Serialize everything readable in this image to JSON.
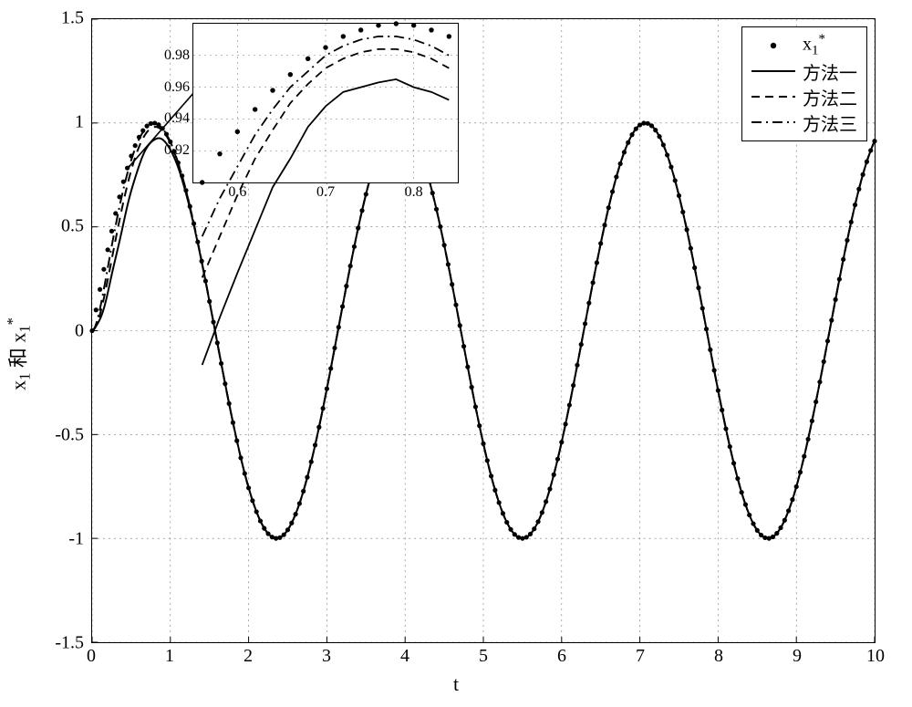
{
  "chart_data": {
    "type": "line",
    "xlabel": "t",
    "ylabel": "x₁ 和 x₁*",
    "x_range": [
      0,
      10
    ],
    "y_range": [
      -1.5,
      1.5
    ],
    "x_ticks": [
      0,
      1,
      2,
      3,
      4,
      5,
      6,
      7,
      8,
      9,
      10
    ],
    "y_ticks": [
      -1.5,
      -1,
      -0.5,
      0,
      0.5,
      1,
      1.5
    ],
    "legend": {
      "position": "upper right",
      "entries": [
        {
          "label": "x₁*",
          "style": "dots"
        },
        {
          "label": "方法一",
          "style": "solid"
        },
        {
          "label": "方法二",
          "style": "dashed"
        },
        {
          "label": "方法三",
          "style": "dashdot"
        }
      ]
    },
    "series": [
      {
        "name": "x₁*",
        "style": "dots",
        "description": "Target trajectory x1* = sin(2t), shown as discrete dots every ≈0.05 in t over [0,10]."
      },
      {
        "name": "方法一",
        "style": "solid",
        "description": "Method 1 response, starts at 0 at t=0, converges toward sin(2t). Undershoots first peak, x1≈0.965 at t≈0.78."
      },
      {
        "name": "方法二",
        "style": "dashed",
        "description": "Method 2 response, converges faster than 方法一, first peak x1≈0.984 at t≈0.78."
      },
      {
        "name": "方法三",
        "style": "dashdot",
        "description": "Method 3 response, nearly matches target, first peak x1≈0.992 at t≈0.78."
      }
    ],
    "note": "After roughly t≈1 all three methods visually coincide with x1* on the main axes, producing a single thick sinusoid sin(2t) of amplitude 1, period π.",
    "annotation_arrow": {
      "from_t": 0.5,
      "from_x": 0.85,
      "to": "inset"
    },
    "inset": {
      "x_range": [
        0.55,
        0.85
      ],
      "y_range": [
        0.9,
        1.0
      ],
      "x_ticks": [
        0.6,
        0.7,
        0.8
      ],
      "y_ticks": [
        0.92,
        0.94,
        0.96,
        0.98
      ],
      "series_detail": {
        "x": [
          0.56,
          0.58,
          0.6,
          0.62,
          0.64,
          0.66,
          0.68,
          0.7,
          0.72,
          0.74,
          0.76,
          0.78,
          0.8,
          0.82,
          0.84
        ],
        "x1_star": [
          0.9,
          0.918,
          0.932,
          0.946,
          0.958,
          0.968,
          0.978,
          0.985,
          0.992,
          0.996,
          0.999,
          1.0,
          0.999,
          0.996,
          0.992
        ],
        "method1": [
          0.785,
          0.815,
          0.843,
          0.87,
          0.897,
          0.915,
          0.935,
          0.948,
          0.957,
          0.96,
          0.963,
          0.965,
          0.96,
          0.957,
          0.952
        ],
        "method2": [
          0.84,
          0.866,
          0.892,
          0.915,
          0.933,
          0.95,
          0.962,
          0.972,
          0.978,
          0.982,
          0.984,
          0.984,
          0.982,
          0.978,
          0.972
        ],
        "method3": [
          0.866,
          0.89,
          0.91,
          0.93,
          0.946,
          0.96,
          0.97,
          0.98,
          0.986,
          0.99,
          0.992,
          0.992,
          0.99,
          0.986,
          0.98
        ]
      }
    }
  },
  "labels": {
    "xlabel": "t",
    "ylabel_prefix": "x",
    "ylabel_sub": "1",
    "ylabel_and": " 和 ",
    "ylabel_suffix_sub": "1",
    "ylabel_suffix_sup": "*",
    "legend0_a": "x",
    "legend0_b": "1",
    "legend0_c": "*",
    "legend1": "方法一",
    "legend2": "方法二",
    "legend3": "方法三",
    "yticks": {
      "0": "-1.5",
      "1": "-1",
      "2": "-0.5",
      "3": "0",
      "4": "0.5",
      "5": "1",
      "6": "1.5"
    },
    "xticks": {
      "0": "0",
      "1": "1",
      "2": "2",
      "3": "3",
      "4": "4",
      "5": "5",
      "6": "6",
      "7": "7",
      "8": "8",
      "9": "9",
      "10": "10"
    },
    "inset_yticks": {
      "0": "0.92",
      "1": "0.94",
      "2": "0.96",
      "3": "0.98"
    },
    "inset_xticks": {
      "0": "0.6",
      "1": "0.7",
      "2": "0.8"
    }
  }
}
